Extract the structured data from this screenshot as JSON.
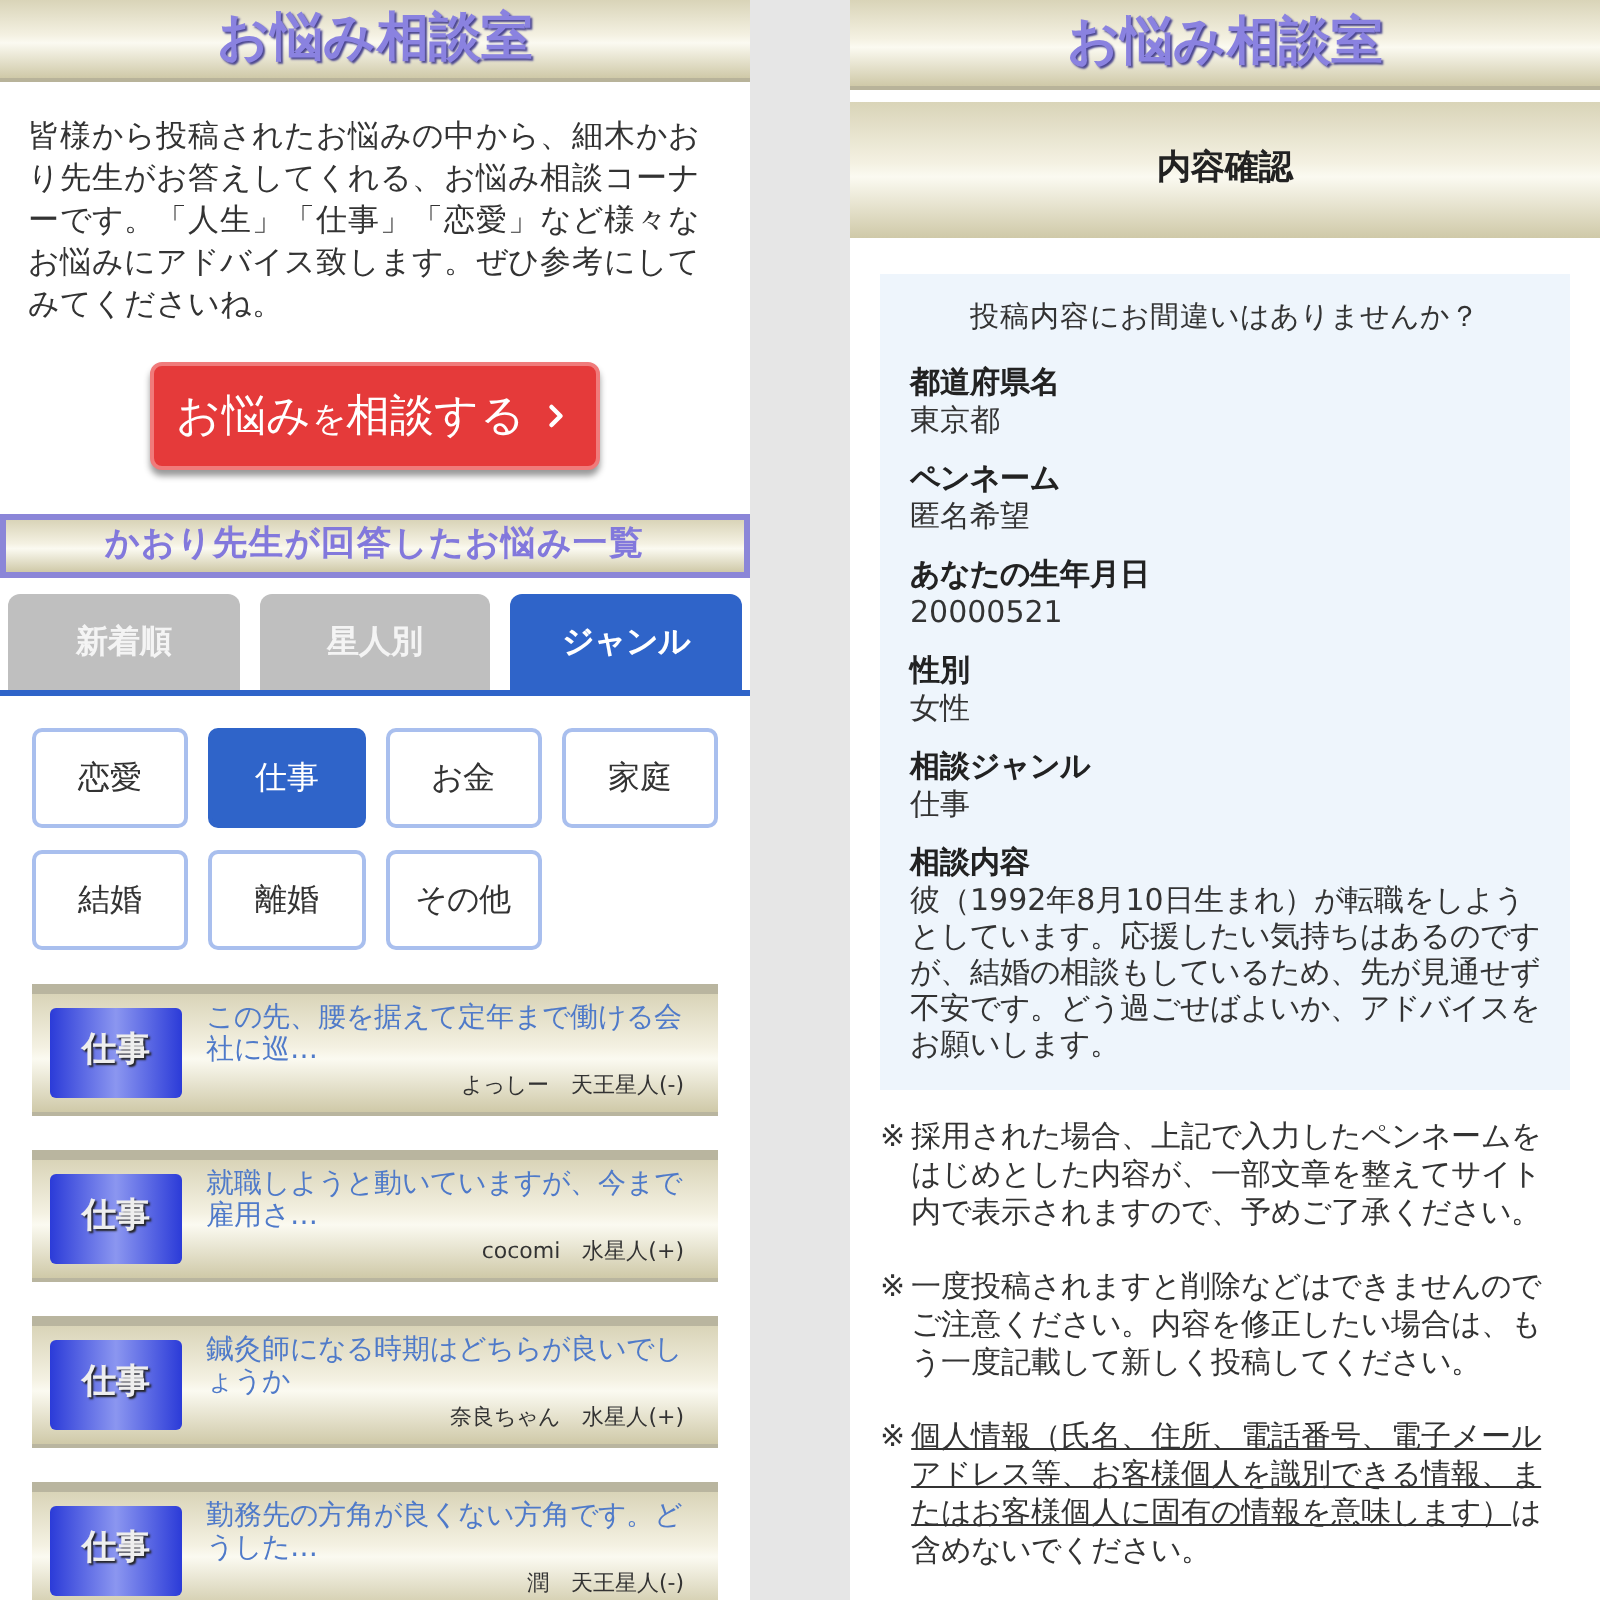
{
  "left_screen": {
    "header": {
      "title": "お悩み相談室"
    },
    "intro": "皆様から投稿されたお悩みの中から、細木かおり先生がお答えしてくれる、お悩み相談コーナーです。「人生」「仕事」「恋愛」など様々なお悩みにアドバイス致します。ぜひ参考にしてみてくださいね。",
    "consult_button": {
      "parts": [
        {
          "text": "お悩み",
          "small": false
        },
        {
          "text": "を",
          "small": true
        },
        {
          "text": "相談する",
          "small": false
        }
      ]
    },
    "section_banner": "かおり先生が回答したお悩み一覧",
    "tabs": [
      {
        "label": "新着順",
        "selected": false
      },
      {
        "label": "星人別",
        "selected": false
      },
      {
        "label": "ジャンル",
        "selected": true
      }
    ],
    "genres": [
      {
        "label": "恋愛",
        "selected": false
      },
      {
        "label": "仕事",
        "selected": true
      },
      {
        "label": "お金",
        "selected": false
      },
      {
        "label": "家庭",
        "selected": false
      },
      {
        "label": "結婚",
        "selected": false
      },
      {
        "label": "離婚",
        "selected": false
      },
      {
        "label": "その他",
        "selected": false
      }
    ],
    "posts": [
      {
        "genre": "仕事",
        "title": "この先、腰を据えて定年まで働ける会社に巡…",
        "author": "よっしー　天王星人(-)"
      },
      {
        "genre": "仕事",
        "title": "就職しようと動いていますが、今まで雇用さ…",
        "author": "cocomi　水星人(+)"
      },
      {
        "genre": "仕事",
        "title": "鍼灸師になる時期はどちらが良いでしょうか",
        "author": "奈良ちゃん　水星人(+)"
      },
      {
        "genre": "仕事",
        "title": "勤務先の方角が良くない方角です。どうした…",
        "author": "潤　天王星人(-)"
      }
    ]
  },
  "right_screen": {
    "header": {
      "title": "お悩み相談室"
    },
    "banner": "内容確認",
    "confirm_box": {
      "question": "投稿内容にお間違いはありませんか？",
      "fields": [
        {
          "label": "都道府県名",
          "value": "東京都"
        },
        {
          "label": "ペンネーム",
          "value": "匿名希望"
        },
        {
          "label": "あなたの生年月日",
          "value": "20000521"
        },
        {
          "label": "性別",
          "value": "女性"
        },
        {
          "label": "相談ジャンル",
          "value": "仕事"
        },
        {
          "label": "相談内容",
          "value": "彼（1992年8月10日生まれ）が転職をしようとしています。応援したい気持ちはあるのですが、結婚の相談もしているため、先が見通せず不安です。どう過ごせばよいか、アドバイスをお願いします。"
        }
      ]
    },
    "notes": [
      {
        "mark": "※",
        "parts": [
          {
            "text": "採用された場合、上記で入力したペンネームをはじめとした内容が、一部文章を整えてサイト内で表示されますので、予めご了承ください。",
            "underline": false
          }
        ]
      },
      {
        "mark": "※",
        "parts": [
          {
            "text": "一度投稿されますと削除などはできませんのでご注意ください。内容を修正したい場合は、もう一度記載して新しく投稿してください。",
            "underline": false
          }
        ]
      },
      {
        "mark": "※",
        "parts": [
          {
            "text": "個人情報（氏名、住所、電話番号、電子メールアドレス等、お客様個人を識別できる情報、またはお客様個人に固有の情報を意味します）",
            "underline": true
          },
          {
            "text": "は含めないでください。",
            "underline": false
          }
        ]
      }
    ]
  }
}
